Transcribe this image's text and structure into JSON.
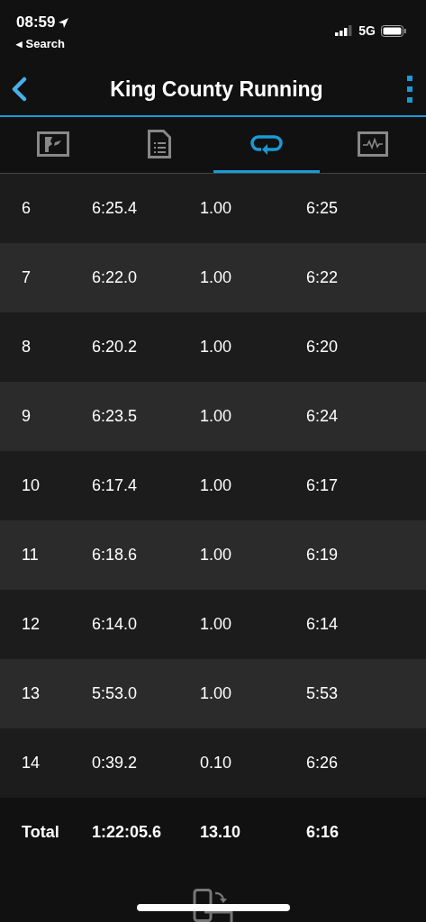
{
  "status_bar": {
    "time": "08:59",
    "back_label": "◂ Search",
    "network": "5G"
  },
  "header": {
    "title": "King County Running"
  },
  "tabs": [
    {
      "kind": "map",
      "selected": false
    },
    {
      "kind": "details",
      "selected": false
    },
    {
      "kind": "laps",
      "selected": true
    },
    {
      "kind": "chart",
      "selected": false
    }
  ],
  "laps": [
    {
      "lap": "6",
      "time": "6:25.4",
      "distance": "1.00",
      "pace": "6:25"
    },
    {
      "lap": "7",
      "time": "6:22.0",
      "distance": "1.00",
      "pace": "6:22"
    },
    {
      "lap": "8",
      "time": "6:20.2",
      "distance": "1.00",
      "pace": "6:20"
    },
    {
      "lap": "9",
      "time": "6:23.5",
      "distance": "1.00",
      "pace": "6:24"
    },
    {
      "lap": "10",
      "time": "6:17.4",
      "distance": "1.00",
      "pace": "6:17"
    },
    {
      "lap": "11",
      "time": "6:18.6",
      "distance": "1.00",
      "pace": "6:19"
    },
    {
      "lap": "12",
      "time": "6:14.0",
      "distance": "1.00",
      "pace": "6:14"
    },
    {
      "lap": "13",
      "time": "5:53.0",
      "distance": "1.00",
      "pace": "5:53"
    },
    {
      "lap": "14",
      "time": "0:39.2",
      "distance": "0.10",
      "pace": "6:26"
    }
  ],
  "total": {
    "label": "Total",
    "time": "1:22:05.6",
    "distance": "13.10",
    "pace": "6:16"
  }
}
